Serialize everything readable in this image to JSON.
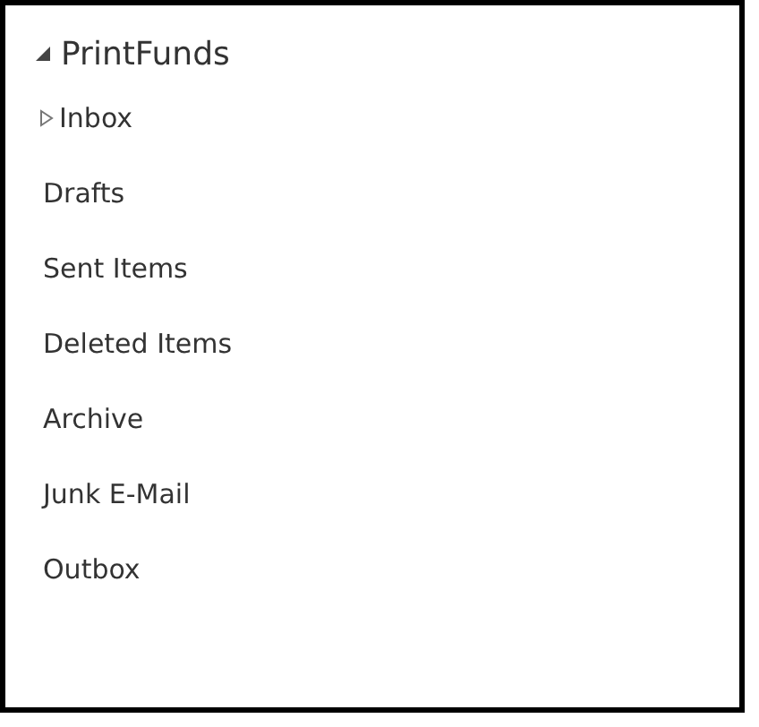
{
  "folders": [
    {
      "label": "PrintFunds",
      "expanded": true,
      "children": [
        {
          "label": "Inbox",
          "expanded": false
        },
        {
          "label": "Drafts"
        },
        {
          "label": "Sent Items"
        },
        {
          "label": "Deleted Items"
        },
        {
          "label": "Archive"
        },
        {
          "label": "Junk E-Mail"
        },
        {
          "label": "Outbox"
        }
      ]
    }
  ]
}
